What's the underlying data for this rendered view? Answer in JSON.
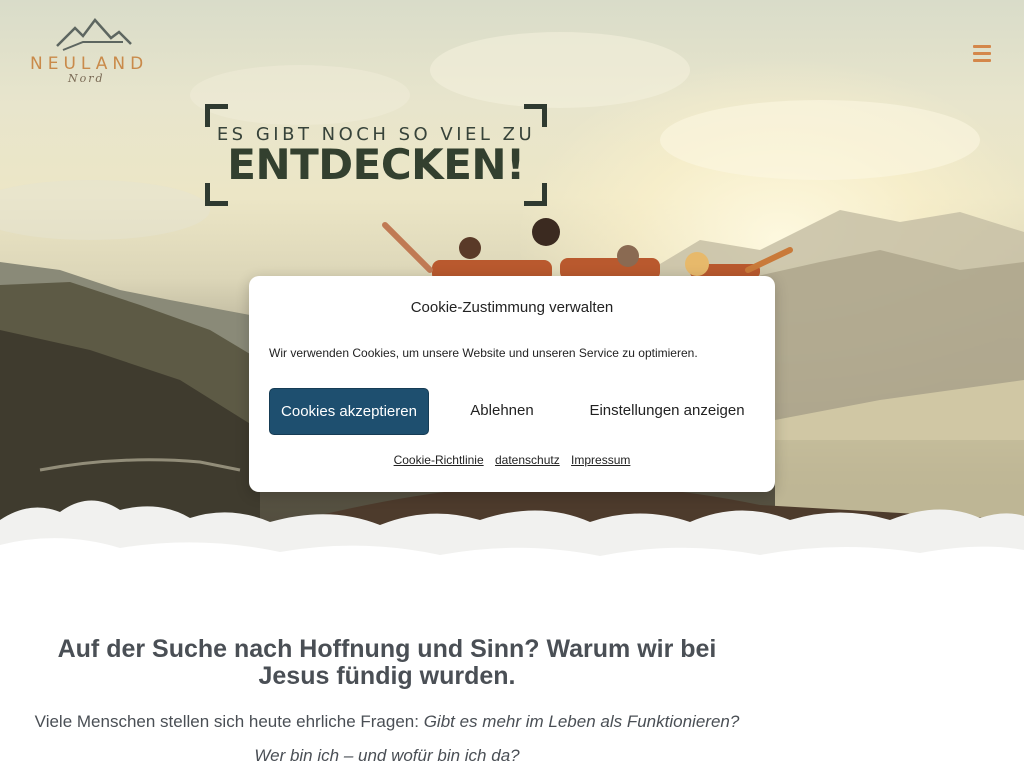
{
  "header": {
    "logo_text": "NEULAND",
    "logo_script": "Nord",
    "menu_icon": "hamburger-icon",
    "menu_color": "#d4874a"
  },
  "hero": {
    "headline_small": "ES GIBT NOCH SO VIEL ZU",
    "headline_big": "ENTDECKEN!"
  },
  "cookie": {
    "title": "Cookie-Zustimmung verwalten",
    "message": "Wir verwenden Cookies, um unsere Website und unseren Service zu optimieren.",
    "accept_label": "Cookies akzeptieren",
    "deny_label": "Ablehnen",
    "settings_label": "Einstellungen anzeigen",
    "accept_color": "#1e4f6f",
    "links": [
      "Cookie-Richtlinie",
      "datenschutz",
      "Impressum"
    ]
  },
  "content": {
    "title": "Auf der Suche nach Hoffnung und Sinn? Warum wir bei Jesus fündig wurden.",
    "p1_plain": "Viele Menschen stellen sich heute ehrliche Fragen: ",
    "p1_italic": "Gibt es mehr im Leben als Funktionieren?",
    "p2": "Wer bin ich – und wofür bin ich da?"
  }
}
